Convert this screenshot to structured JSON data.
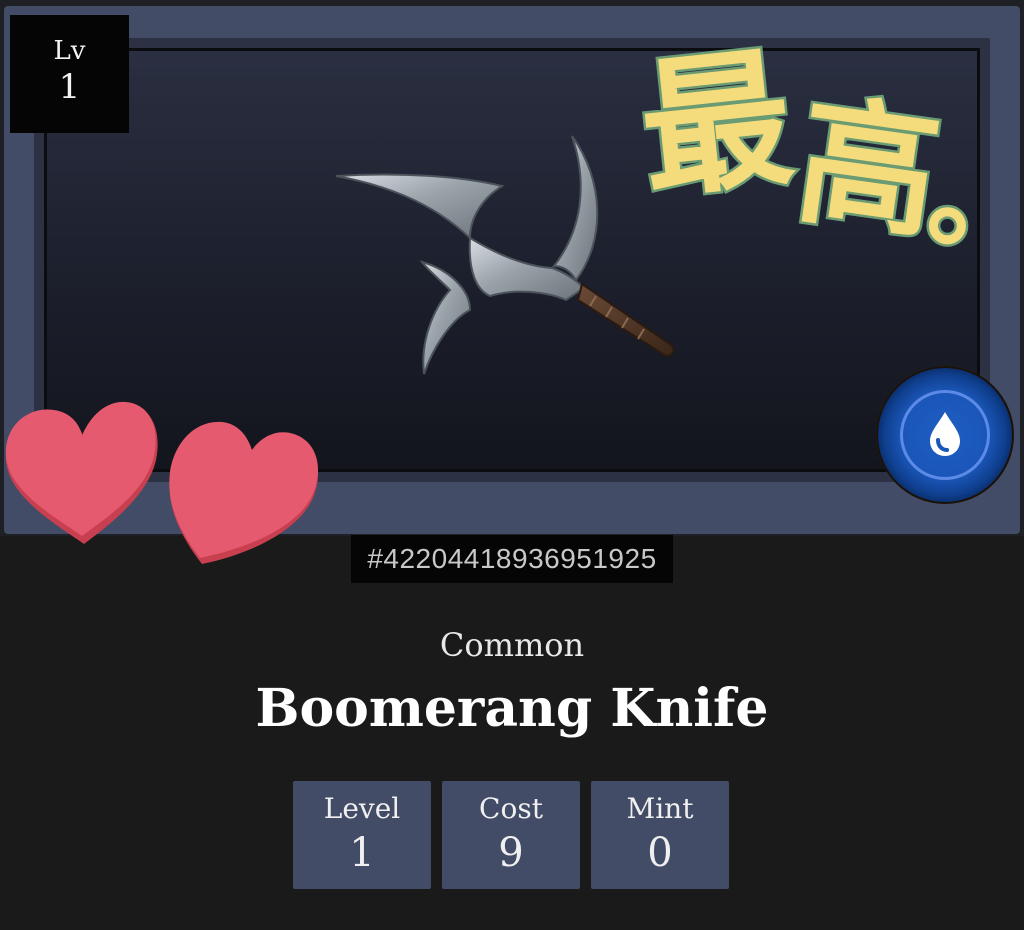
{
  "card": {
    "level_badge": {
      "label": "Lv",
      "value": "1"
    },
    "element": "water",
    "sticker_text": [
      "最",
      "高",
      "。"
    ],
    "token_id": "#42204418936951925",
    "rarity": "Common",
    "name": "Boomerang Knife",
    "stats": [
      {
        "label": "Level",
        "value": "1"
      },
      {
        "label": "Cost",
        "value": "9"
      },
      {
        "label": "Mint",
        "value": "0"
      }
    ]
  },
  "colors": {
    "background": "#1a1a1a",
    "frame": "#434c67",
    "stat_box": "#434c67",
    "heart": "#e65a70",
    "sticker_fill": "#f4dc7c",
    "sticker_outline": "#6a9b73",
    "orb": "#1a56b8"
  },
  "icons": {
    "element": "water-drop-icon",
    "decorations": [
      "heart-icon",
      "heart-icon"
    ]
  }
}
